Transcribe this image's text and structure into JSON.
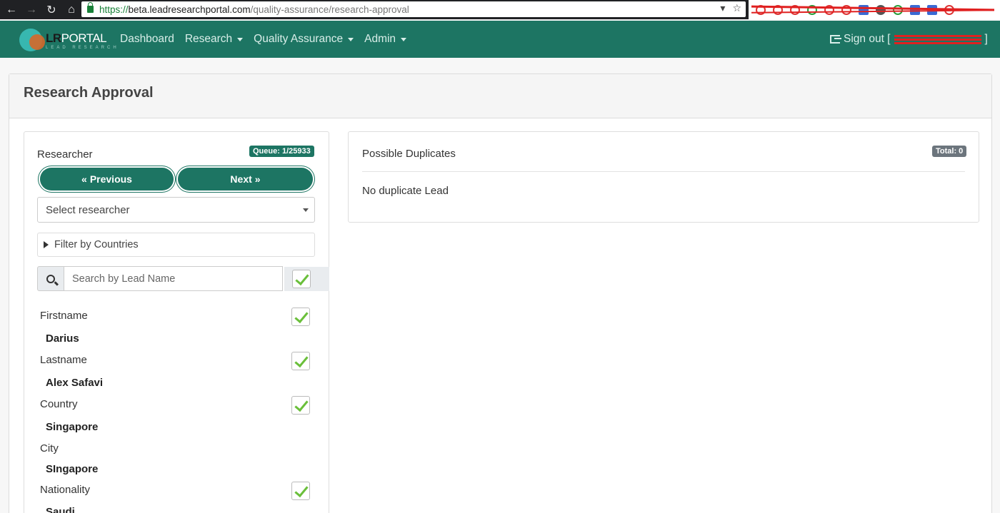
{
  "browser": {
    "url_scheme": "https://",
    "url_host": "beta.leadresearchportal.com",
    "url_path": "/quality-assurance/research-approval"
  },
  "navbar": {
    "logo_bold": "LR",
    "logo_rest": "PORTAL",
    "logo_sub": "LEAD RESEARCH",
    "links": [
      "Dashboard",
      "Research",
      "Quality Assurance",
      "Admin"
    ],
    "signout_label": "Sign out [",
    "signout_close": "]"
  },
  "page": {
    "title": "Research Approval"
  },
  "left": {
    "researcher_label": "Researcher",
    "queue_badge": "Queue: 1/25933",
    "prev_label": "Previous",
    "next_label": "Next",
    "select_value": "Select researcher",
    "filter_label": "Filter by Countries",
    "search_placeholder": "Search by Lead Name",
    "fields": [
      {
        "label": "Firstname",
        "value": "Darius",
        "checked": true
      },
      {
        "label": "Lastname",
        "value": "Alex Safavi",
        "checked": true
      },
      {
        "label": "Country",
        "value": "Singapore",
        "checked": true
      },
      {
        "label": "City",
        "value": "SIngapore",
        "checked": false
      },
      {
        "label": "Nationality",
        "value": "Saudi",
        "checked": true
      }
    ]
  },
  "right": {
    "title": "Possible Duplicates",
    "total_badge": "Total: 0",
    "empty_message": "No duplicate Lead"
  },
  "colors": {
    "brand": "#1d7563",
    "check": "#6abf3a"
  }
}
